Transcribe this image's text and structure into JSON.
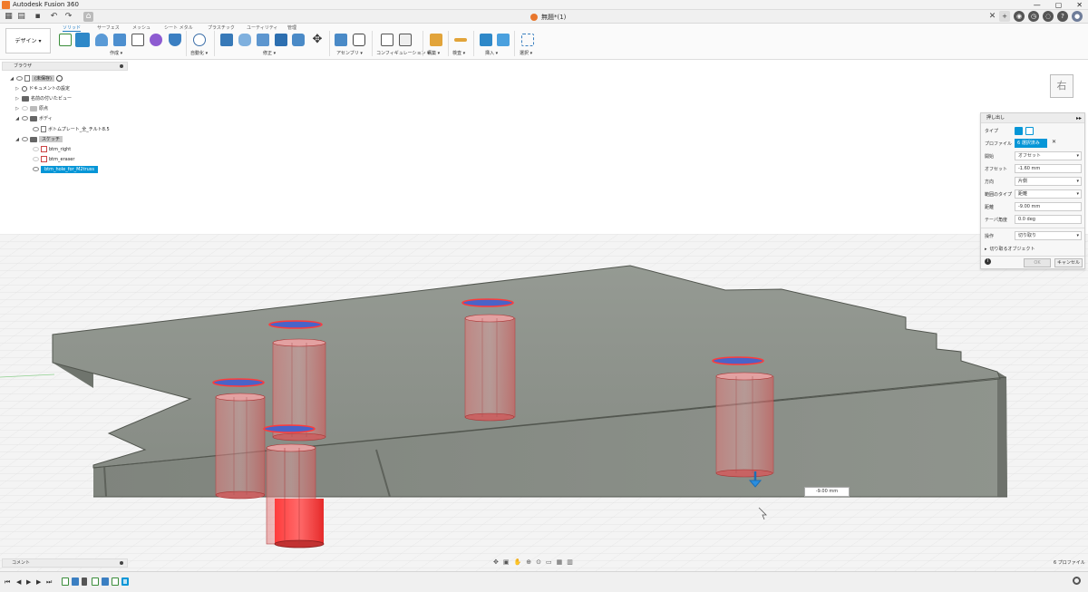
{
  "titlebar": {
    "title": "Autodesk Fusion 360",
    "min": "—",
    "max": "▢",
    "close": "✕"
  },
  "document": {
    "name": "無題*(1)"
  },
  "workspace": {
    "label": "デザイン ▾"
  },
  "ribbon": {
    "tabs": [
      "ソリッド",
      "サーフェス",
      "メッシュ",
      "シート メタル",
      "プラスチック",
      "ユーティリティ",
      "管理"
    ],
    "groups": [
      "作成 ▾",
      "自動化 ▾",
      "修正 ▾",
      "アセンブリ ▾",
      "コンフィギュレーション ▾",
      "構築 ▾",
      "検査 ▾",
      "挿入 ▾",
      "選択 ▾"
    ]
  },
  "browser": {
    "title": "ブラウザ",
    "items": [
      {
        "label": "(未保存)"
      },
      {
        "label": "ドキュメントの設定"
      },
      {
        "label": "名前の付いたビュー"
      },
      {
        "label": "原点"
      },
      {
        "label": "ボディ"
      },
      {
        "label": "ボトムプレート_全_チルト8.5"
      },
      {
        "label": "スケッチ"
      },
      {
        "label": "btm_right"
      },
      {
        "label": "btm_eraser"
      },
      {
        "label": "btm_hole_for_M2truss"
      }
    ]
  },
  "viewcube": {
    "face": "右"
  },
  "extrude_panel": {
    "title": "押し出し",
    "rows": [
      {
        "label": "タイプ",
        "value": ""
      },
      {
        "label": "プロファイル",
        "value": "6 選択済み"
      },
      {
        "label": "開始",
        "value": "オフセット"
      },
      {
        "label": "オフセット",
        "value": "-1.60 mm"
      },
      {
        "label": "方向",
        "value": "片側"
      },
      {
        "label": "範囲のタイプ",
        "value": "距離"
      },
      {
        "label": "距離",
        "value": "-9.00 mm"
      },
      {
        "label": "テーパ角度",
        "value": "0.0 deg"
      },
      {
        "label": "操作",
        "value": "切り取り"
      }
    ],
    "objects_to_cut": "切り取るオブジェクト",
    "ok": "OK",
    "cancel": "キャンセル",
    "info": "i"
  },
  "viewport": {
    "dimension_value": "-9.00 mm"
  },
  "comments": {
    "label": "コメント"
  },
  "status": {
    "profiles": "6 プロファイル"
  },
  "nav_icons": [
    "orbit-icon",
    "pan-icon",
    "zoom-icon",
    "fit-icon",
    "display-icon",
    "grid-icon",
    "viewports-icon"
  ],
  "colors": {
    "accent": "#0696d7",
    "body": "#8c9189",
    "cut": "#e33b3b"
  }
}
